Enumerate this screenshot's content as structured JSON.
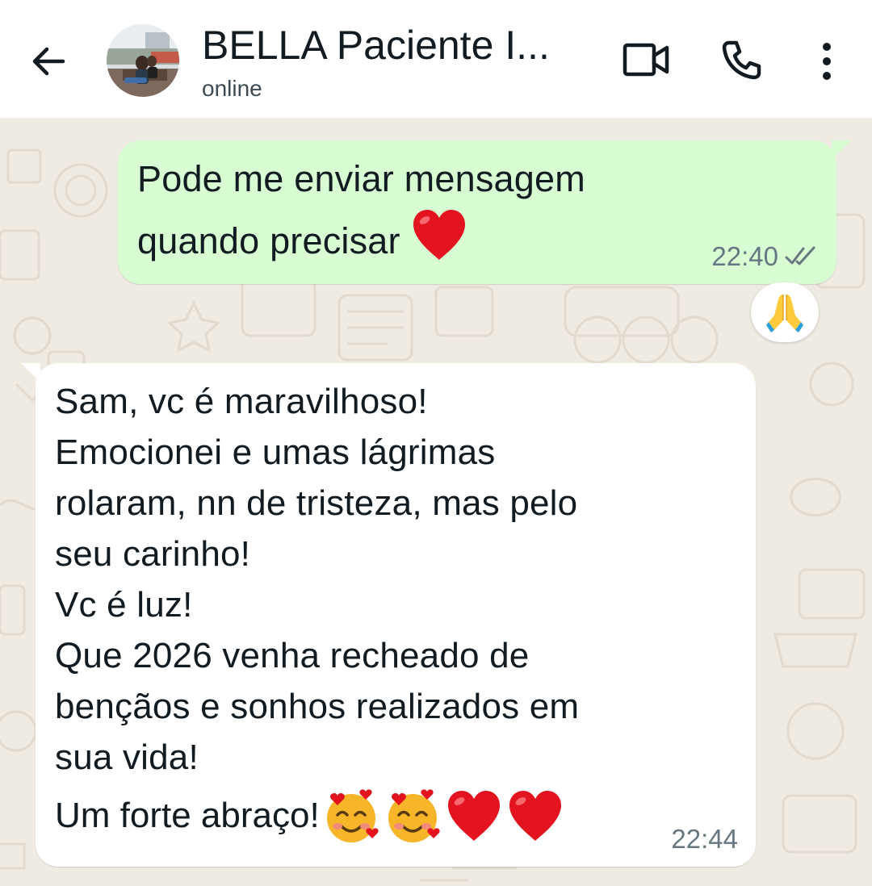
{
  "header": {
    "contact_name": "BELLA Paciente I...",
    "status": "online",
    "back_icon": "arrow-left-icon",
    "video_icon": "video-call-icon",
    "call_icon": "phone-icon",
    "menu_icon": "more-vertical-icon"
  },
  "messages": [
    {
      "direction": "outgoing",
      "text": "Pode me enviar mensagem\nquando precisar",
      "emoji": "red-heart",
      "time": "22:40",
      "status_icon": "double-check-icon",
      "reaction": "folded-hands"
    },
    {
      "direction": "incoming",
      "text": "Sam, vc é maravilhoso!\nEmocionei e umas lágrimas\nrolaram, nn de tristeza, mas pelo\nseu carinho!\nVc é luz!\nQue 2026 venha recheado de\nbençãos e sonhos realizados em\nsua vida!",
      "last_line": "Um forte abraço!",
      "emojis": [
        "smiling-face-with-hearts",
        "smiling-face-with-hearts",
        "red-heart",
        "red-heart"
      ],
      "time": "22:44"
    }
  ],
  "colors": {
    "wallpaper": "#efeae2",
    "outgoing_bubble": "#d9fdd3",
    "incoming_bubble": "#ffffff",
    "meta_text": "#667781"
  }
}
